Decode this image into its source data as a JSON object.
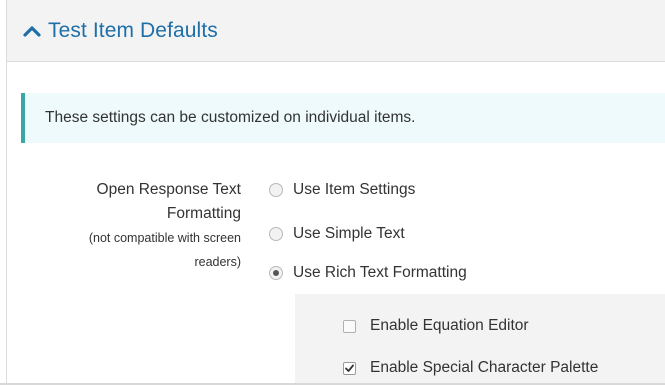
{
  "section": {
    "title": "Test Item Defaults",
    "collapse_icon": "chevron-up-icon"
  },
  "info_message": "These settings can be customized on individual items.",
  "open_response": {
    "label_line1": "Open Response Text",
    "label_line2": "Formatting",
    "note_line1": "(not compatible with screen",
    "note_line2": "readers)",
    "options": [
      {
        "label": "Use Item Settings",
        "selected": false
      },
      {
        "label": "Use Simple Text",
        "selected": false
      },
      {
        "label": "Use Rich Text Formatting",
        "selected": true
      }
    ]
  },
  "rich_text_options": [
    {
      "label": "Enable Equation Editor",
      "checked": false
    },
    {
      "label": "Enable Special Character Palette",
      "checked": true
    }
  ],
  "colors": {
    "header_bg": "#f3f3f3",
    "title": "#1e6fa8",
    "info_bg": "#eefafb",
    "info_border": "#3aa7a6"
  }
}
